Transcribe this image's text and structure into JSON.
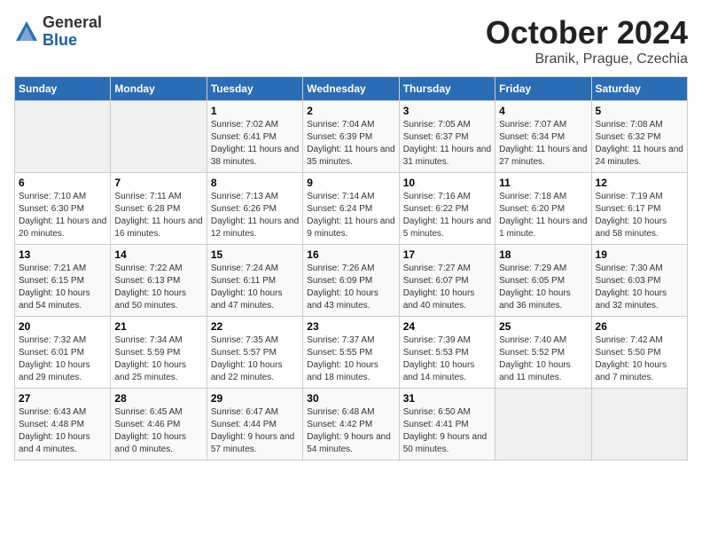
{
  "logo": {
    "general": "General",
    "blue": "Blue"
  },
  "title": "October 2024",
  "subtitle": "Branik, Prague, Czechia",
  "days_of_week": [
    "Sunday",
    "Monday",
    "Tuesday",
    "Wednesday",
    "Thursday",
    "Friday",
    "Saturday"
  ],
  "weeks": [
    [
      {
        "day": "",
        "empty": true
      },
      {
        "day": "",
        "empty": true
      },
      {
        "day": "1",
        "sunrise": "Sunrise: 7:02 AM",
        "sunset": "Sunset: 6:41 PM",
        "daylight": "Daylight: 11 hours and 38 minutes."
      },
      {
        "day": "2",
        "sunrise": "Sunrise: 7:04 AM",
        "sunset": "Sunset: 6:39 PM",
        "daylight": "Daylight: 11 hours and 35 minutes."
      },
      {
        "day": "3",
        "sunrise": "Sunrise: 7:05 AM",
        "sunset": "Sunset: 6:37 PM",
        "daylight": "Daylight: 11 hours and 31 minutes."
      },
      {
        "day": "4",
        "sunrise": "Sunrise: 7:07 AM",
        "sunset": "Sunset: 6:34 PM",
        "daylight": "Daylight: 11 hours and 27 minutes."
      },
      {
        "day": "5",
        "sunrise": "Sunrise: 7:08 AM",
        "sunset": "Sunset: 6:32 PM",
        "daylight": "Daylight: 11 hours and 24 minutes."
      }
    ],
    [
      {
        "day": "6",
        "sunrise": "Sunrise: 7:10 AM",
        "sunset": "Sunset: 6:30 PM",
        "daylight": "Daylight: 11 hours and 20 minutes."
      },
      {
        "day": "7",
        "sunrise": "Sunrise: 7:11 AM",
        "sunset": "Sunset: 6:28 PM",
        "daylight": "Daylight: 11 hours and 16 minutes."
      },
      {
        "day": "8",
        "sunrise": "Sunrise: 7:13 AM",
        "sunset": "Sunset: 6:26 PM",
        "daylight": "Daylight: 11 hours and 12 minutes."
      },
      {
        "day": "9",
        "sunrise": "Sunrise: 7:14 AM",
        "sunset": "Sunset: 6:24 PM",
        "daylight": "Daylight: 11 hours and 9 minutes."
      },
      {
        "day": "10",
        "sunrise": "Sunrise: 7:16 AM",
        "sunset": "Sunset: 6:22 PM",
        "daylight": "Daylight: 11 hours and 5 minutes."
      },
      {
        "day": "11",
        "sunrise": "Sunrise: 7:18 AM",
        "sunset": "Sunset: 6:20 PM",
        "daylight": "Daylight: 11 hours and 1 minute."
      },
      {
        "day": "12",
        "sunrise": "Sunrise: 7:19 AM",
        "sunset": "Sunset: 6:17 PM",
        "daylight": "Daylight: 10 hours and 58 minutes."
      }
    ],
    [
      {
        "day": "13",
        "sunrise": "Sunrise: 7:21 AM",
        "sunset": "Sunset: 6:15 PM",
        "daylight": "Daylight: 10 hours and 54 minutes."
      },
      {
        "day": "14",
        "sunrise": "Sunrise: 7:22 AM",
        "sunset": "Sunset: 6:13 PM",
        "daylight": "Daylight: 10 hours and 50 minutes."
      },
      {
        "day": "15",
        "sunrise": "Sunrise: 7:24 AM",
        "sunset": "Sunset: 6:11 PM",
        "daylight": "Daylight: 10 hours and 47 minutes."
      },
      {
        "day": "16",
        "sunrise": "Sunrise: 7:26 AM",
        "sunset": "Sunset: 6:09 PM",
        "daylight": "Daylight: 10 hours and 43 minutes."
      },
      {
        "day": "17",
        "sunrise": "Sunrise: 7:27 AM",
        "sunset": "Sunset: 6:07 PM",
        "daylight": "Daylight: 10 hours and 40 minutes."
      },
      {
        "day": "18",
        "sunrise": "Sunrise: 7:29 AM",
        "sunset": "Sunset: 6:05 PM",
        "daylight": "Daylight: 10 hours and 36 minutes."
      },
      {
        "day": "19",
        "sunrise": "Sunrise: 7:30 AM",
        "sunset": "Sunset: 6:03 PM",
        "daylight": "Daylight: 10 hours and 32 minutes."
      }
    ],
    [
      {
        "day": "20",
        "sunrise": "Sunrise: 7:32 AM",
        "sunset": "Sunset: 6:01 PM",
        "daylight": "Daylight: 10 hours and 29 minutes."
      },
      {
        "day": "21",
        "sunrise": "Sunrise: 7:34 AM",
        "sunset": "Sunset: 5:59 PM",
        "daylight": "Daylight: 10 hours and 25 minutes."
      },
      {
        "day": "22",
        "sunrise": "Sunrise: 7:35 AM",
        "sunset": "Sunset: 5:57 PM",
        "daylight": "Daylight: 10 hours and 22 minutes."
      },
      {
        "day": "23",
        "sunrise": "Sunrise: 7:37 AM",
        "sunset": "Sunset: 5:55 PM",
        "daylight": "Daylight: 10 hours and 18 minutes."
      },
      {
        "day": "24",
        "sunrise": "Sunrise: 7:39 AM",
        "sunset": "Sunset: 5:53 PM",
        "daylight": "Daylight: 10 hours and 14 minutes."
      },
      {
        "day": "25",
        "sunrise": "Sunrise: 7:40 AM",
        "sunset": "Sunset: 5:52 PM",
        "daylight": "Daylight: 10 hours and 11 minutes."
      },
      {
        "day": "26",
        "sunrise": "Sunrise: 7:42 AM",
        "sunset": "Sunset: 5:50 PM",
        "daylight": "Daylight: 10 hours and 7 minutes."
      }
    ],
    [
      {
        "day": "27",
        "sunrise": "Sunrise: 6:43 AM",
        "sunset": "Sunset: 4:48 PM",
        "daylight": "Daylight: 10 hours and 4 minutes."
      },
      {
        "day": "28",
        "sunrise": "Sunrise: 6:45 AM",
        "sunset": "Sunset: 4:46 PM",
        "daylight": "Daylight: 10 hours and 0 minutes."
      },
      {
        "day": "29",
        "sunrise": "Sunrise: 6:47 AM",
        "sunset": "Sunset: 4:44 PM",
        "daylight": "Daylight: 9 hours and 57 minutes."
      },
      {
        "day": "30",
        "sunrise": "Sunrise: 6:48 AM",
        "sunset": "Sunset: 4:42 PM",
        "daylight": "Daylight: 9 hours and 54 minutes."
      },
      {
        "day": "31",
        "sunrise": "Sunrise: 6:50 AM",
        "sunset": "Sunset: 4:41 PM",
        "daylight": "Daylight: 9 hours and 50 minutes."
      },
      {
        "day": "",
        "empty": true
      },
      {
        "day": "",
        "empty": true
      }
    ]
  ]
}
